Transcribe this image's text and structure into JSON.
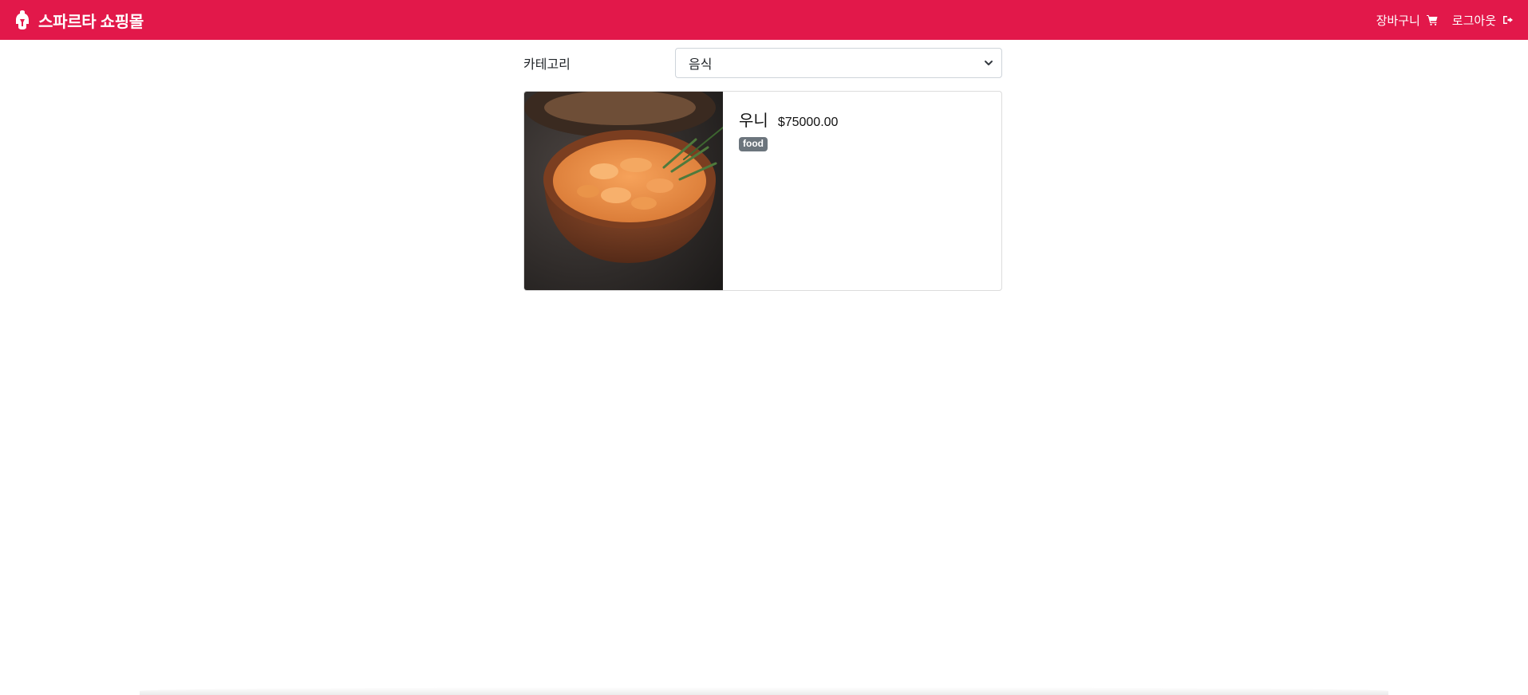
{
  "navbar": {
    "brand_icon": "spartan-helmet-icon",
    "brand_text": "스파르타 쇼핑몰",
    "background_color": "#e2184a",
    "links": [
      {
        "label": "장바구니",
        "icon": "cart-icon"
      },
      {
        "label": "로그아웃",
        "icon": "logout-icon"
      }
    ]
  },
  "filter": {
    "label": "카테고리",
    "selected": "음식",
    "icon": "chevron-down-icon"
  },
  "products": [
    {
      "name": "우니",
      "price": "$75000.00",
      "category_badge": "food",
      "image": "sea-urchin-bowl-photo"
    }
  ]
}
